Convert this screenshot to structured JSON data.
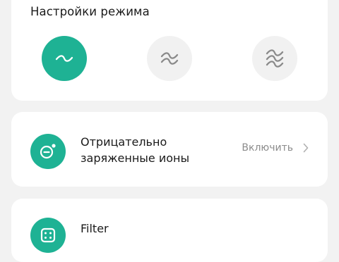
{
  "mode_settings": {
    "title": "Настройки режима",
    "modes": [
      {
        "icon": "wave-low-icon",
        "active": true
      },
      {
        "icon": "wave-medium-icon",
        "active": false
      },
      {
        "icon": "wave-high-icon",
        "active": false
      }
    ]
  },
  "ions": {
    "title_line1": "Отрицательно",
    "title_line2": "заряженные ионы",
    "action_label": "Включить",
    "icon": "negative-ion-icon"
  },
  "filter": {
    "title": "Filter",
    "icon": "filter-icon"
  },
  "colors": {
    "accent": "#1eb294",
    "background": "#f2f2f2",
    "card": "#ffffff",
    "inactive_button": "#f1f1f1",
    "inactive_glyph": "#8a8a8a",
    "secondary_text": "#8c8c8c"
  }
}
